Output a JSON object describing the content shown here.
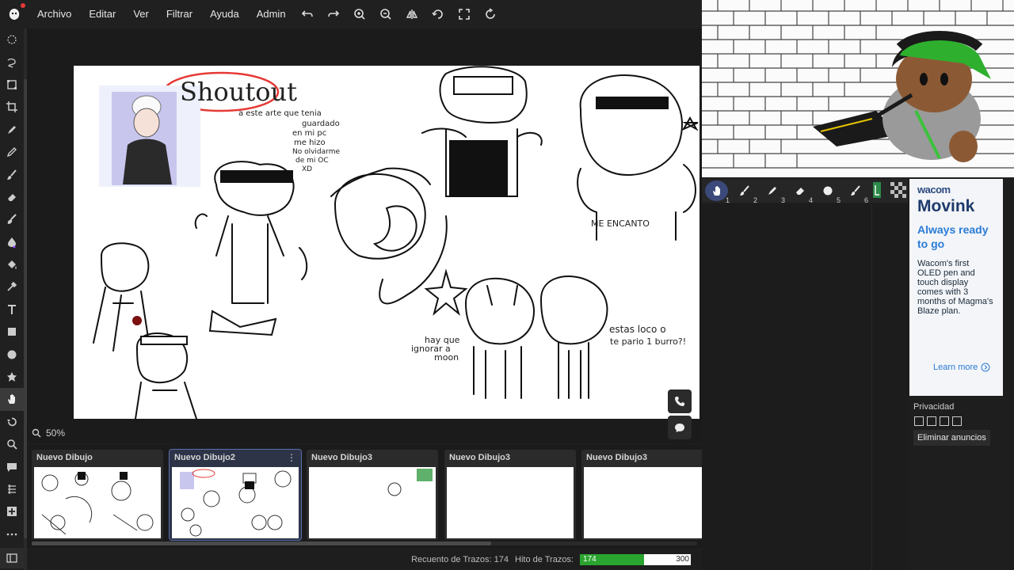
{
  "menu": {
    "items": [
      "Archivo",
      "Editar",
      "Ver",
      "Filtrar",
      "Ayuda",
      "Admin"
    ]
  },
  "toolbar_icons": [
    "undo-icon",
    "redo-icon",
    "zoom-in-icon",
    "zoom-out-icon",
    "flip-icon",
    "rotate-icon",
    "fullscreen-icon",
    "reset-rotation-icon"
  ],
  "left_tools": [
    "lasso-select-icon",
    "lasso-icon",
    "select-rect-icon",
    "crop-icon",
    "pen-icon",
    "pencil-icon",
    "brush-icon",
    "eraser-icon",
    "smudge-icon",
    "blur-icon",
    "fill-icon",
    "eyedropper-icon",
    "text-icon",
    "rect-shape-icon",
    "circle-shape-icon",
    "star-shape-icon",
    "hand-icon",
    "undo-tool-icon",
    "search-tool-icon",
    "chat-icon",
    "layers-icon",
    "add-icon",
    "more-icon"
  ],
  "canvas": {
    "texts": {
      "shoutout": "Shoutout",
      "note1": "a este arte que tenia",
      "note2": "guardado",
      "note3": "en mi pc",
      "note4": "me hizo",
      "note5": "No olvidarme",
      "note6": "de mi OC",
      "note7": "XD",
      "me_encanto": "ME ENCANTO",
      "hay_que": "hay que",
      "ignorar": "ignorar a",
      "moon": "moon",
      "estas": "estas loco o",
      "te_pario": "te pario 1 burro?!"
    }
  },
  "zoom": {
    "label": "50%"
  },
  "thumbnails": [
    {
      "title": "Nuevo Dibujo",
      "active": false
    },
    {
      "title": "Nuevo Dibujo2",
      "active": true
    },
    {
      "title": "Nuevo Dibujo3",
      "active": false
    },
    {
      "title": "Nuevo Dibujo3",
      "active": false
    },
    {
      "title": "Nuevo Dibujo3",
      "active": false
    }
  ],
  "status": {
    "stroke_count_label": "Recuento de Trazos: 174",
    "stroke_limit_label": "Hito de Trazos:",
    "stroke_value": "174",
    "stroke_max": "300",
    "stroke_fraction": 0.58
  },
  "brushes": [
    {
      "num": "1",
      "icon": "hand-icon"
    },
    {
      "num": "2",
      "icon": "brush-icon"
    },
    {
      "num": "3",
      "icon": "pen-icon"
    },
    {
      "num": "4",
      "icon": "eraser-icon"
    },
    {
      "num": "5",
      "icon": "circle-icon"
    },
    {
      "num": "6",
      "icon": "brush-icon"
    }
  ],
  "ad": {
    "brand": "wacom",
    "product": "Movink",
    "tagline": "Always ready to go",
    "body": "Wacom's first OLED pen and touch display comes with 3 months of Magma's Blaze plan.",
    "cta": "Learn more"
  },
  "privacy": {
    "label": "Privacidad",
    "remove_ads": "Eliminar anuncios"
  },
  "colors": {
    "accent": "#3b4a7a",
    "progress": "#2aa52f",
    "logo_dot": "#e53935"
  }
}
